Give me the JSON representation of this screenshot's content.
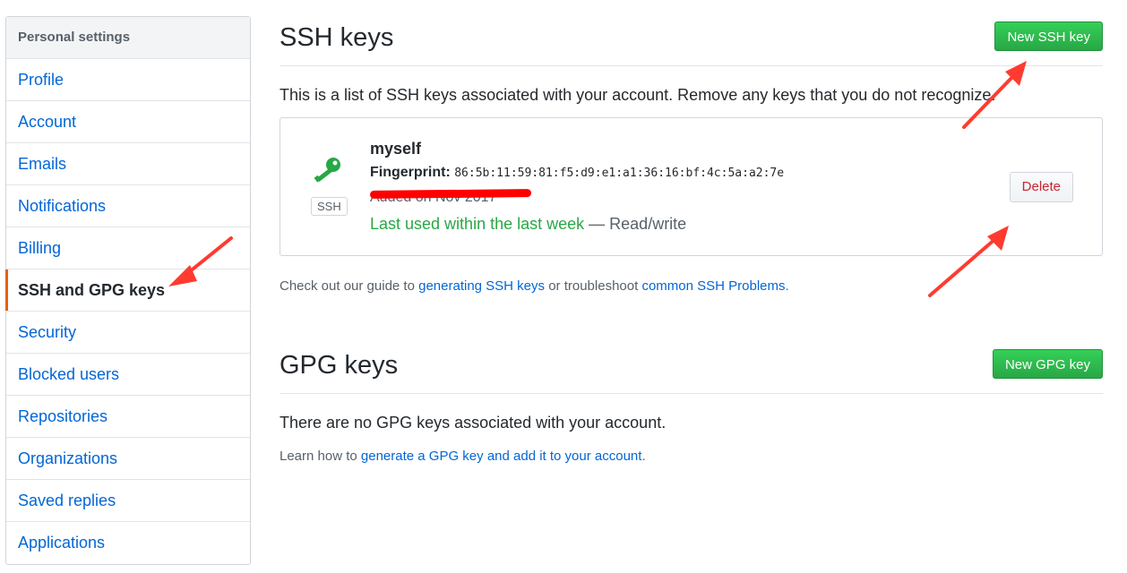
{
  "sidebar": {
    "header": "Personal settings",
    "items": [
      {
        "label": "Profile"
      },
      {
        "label": "Account"
      },
      {
        "label": "Emails"
      },
      {
        "label": "Notifications"
      },
      {
        "label": "Billing"
      },
      {
        "label": "SSH and GPG keys"
      },
      {
        "label": "Security"
      },
      {
        "label": "Blocked users"
      },
      {
        "label": "Repositories"
      },
      {
        "label": "Organizations"
      },
      {
        "label": "Saved replies"
      },
      {
        "label": "Applications"
      }
    ],
    "selected_index": 5
  },
  "ssh": {
    "title": "SSH keys",
    "new_button": "New SSH key",
    "description": "This is a list of SSH keys associated with your account. Remove any keys that you do not recognize.",
    "key": {
      "icon": "key-icon",
      "type_label": "SSH",
      "name": "myself",
      "fingerprint_label": "Fingerprint:",
      "fingerprint": "86:5b:11:59:81:f5:d9:e1:a1:36:16:bf:4c:5a:a2:7e",
      "added": "Added on Nov 2017",
      "last_used": "Last used within the last week",
      "access": "— Read/write",
      "delete_button": "Delete"
    },
    "help": {
      "prefix": "Check out our guide to ",
      "link1": "generating SSH keys",
      "middle": " or troubleshoot ",
      "link2": "common SSH Problems",
      "suffix": "."
    }
  },
  "gpg": {
    "title": "GPG keys",
    "new_button": "New GPG key",
    "empty": "There are no GPG keys associated with your account.",
    "help": {
      "prefix": "Learn how to ",
      "link": "generate a GPG key and add it to your account",
      "suffix": "."
    }
  },
  "colors": {
    "accent_green": "#28a745",
    "link_blue": "#0366d6",
    "selected_marker": "#e36209",
    "annotation_red": "#ff3b30"
  }
}
